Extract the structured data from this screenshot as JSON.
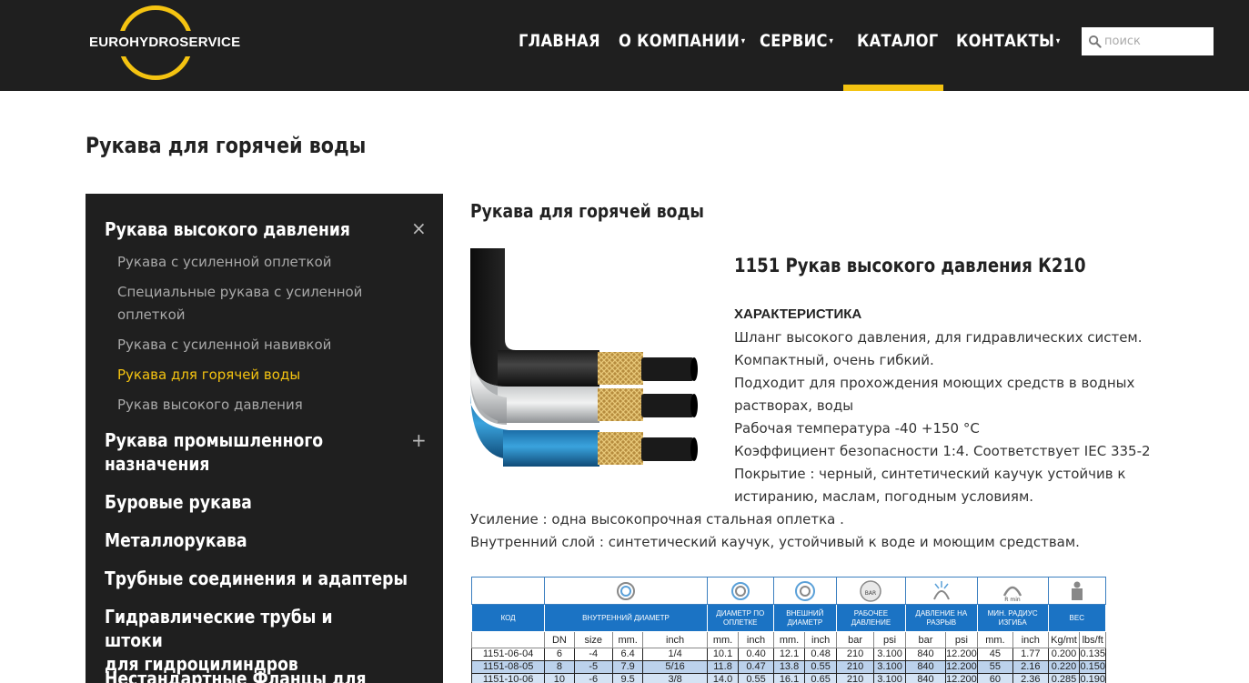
{
  "header": {
    "logo_text": "EUROHYDROSERVICE",
    "nav": [
      {
        "label": "ГЛАВНАЯ",
        "has_dropdown": false
      },
      {
        "label": "О КОМПАНИИ",
        "has_dropdown": true
      },
      {
        "label": "СЕРВИС",
        "has_dropdown": true
      },
      {
        "label": "КАТАЛОГ",
        "has_dropdown": false,
        "active": true
      },
      {
        "label": "КОНТАКТЫ",
        "has_dropdown": true
      }
    ],
    "dropdown_caret": "▾",
    "search_placeholder": "поиск"
  },
  "page_title": "Рукава для горячей воды",
  "sidebar": {
    "categories": [
      {
        "label": "Рукава высокого давления",
        "toggle": "×"
      },
      {
        "label": "Рукава промышленного\nназначения",
        "toggle": "+"
      },
      {
        "label": "Буровые рукава"
      },
      {
        "label": "Металлорукава"
      },
      {
        "label": "Трубные соединения и адаптеры"
      },
      {
        "label": "Гидравлические трубы и штоки\nдля гидроцилиндров"
      },
      {
        "label": "Нестандартные Фланцы для"
      }
    ],
    "subitems": [
      {
        "label": "Рукава с усиленной оплеткой"
      },
      {
        "label": "Специальные рукава с усиленной оплеткой"
      },
      {
        "label": "Рукава с усиленной навивкой"
      },
      {
        "label": "Рукава для горячей воды",
        "active": true
      },
      {
        "label": "Рукав высокого давления"
      }
    ]
  },
  "content": {
    "section_title": "Рукава для горячей воды",
    "product_title": "1151 Рукав высокого давления К210",
    "spec_heading": "ХАРАКТЕРИСТИКА",
    "spec_lines": [
      "Шланг высокого давления, для гидравлических систем.",
      "Компактный, очень гибкий.",
      "Подходит для прохождения моющих средств в водных",
      "растворах, воды",
      "Рабочая температура -40  +150 °С",
      "Коэффициент безопасности 1:4. Соответствует IEC 335-2",
      "Покрытие : черный, синтетический каучук устойчив к",
      "истиранию, маслам, погодным условиям.",
      "Усиление : одна высокопрочная стальная оплетка .",
      "Внутренний слой : синтетический каучук, устойчивый к воде и моющим средствам."
    ],
    "colors": {
      "accent": "#f4c311",
      "header_bg": "#1f1f1f",
      "table_header": "#1b73c4"
    }
  },
  "table": {
    "icon_badges": {
      "pressure": "BAR",
      "bend": "R min"
    },
    "headers": {
      "code": "КОД",
      "inner": "ВНУТРЕННИЙ ДИАМЕТР",
      "braid": "ДИАМЕТР ПО ОПЛЕТКЕ",
      "outer": "ВНЕШНИЙ ДИАМЕТР",
      "work": "РАБОЧЕЕ ДАВЛЕНИЕ",
      "burst": "ДАВЛЕНИЕ НА РАЗРЫВ",
      "bend": "МИН. РАДИУС ИЗГИБА",
      "weight": "ВЕС"
    },
    "units": [
      "DN",
      "size",
      "mm.",
      "inch",
      "mm.",
      "inch",
      "mm.",
      "inch",
      "bar",
      "psi",
      "bar",
      "psi",
      "mm.",
      "inch",
      "Kg/mt",
      "lbs/ft"
    ],
    "rows": [
      [
        "1151-06-04",
        "6",
        "-4",
        "6.4",
        "1/4",
        "10.1",
        "0.40",
        "12.1",
        "0.48",
        "210",
        "3.100",
        "840",
        "12.200",
        "45",
        "1.77",
        "0.200",
        "0.135"
      ],
      [
        "1151-08-05",
        "8",
        "-5",
        "7.9",
        "5/16",
        "11.8",
        "0.47",
        "13.8",
        "0.55",
        "210",
        "3.100",
        "840",
        "12.200",
        "55",
        "2.16",
        "0.220",
        "0.150"
      ],
      [
        "1151-10-06",
        "10",
        "-6",
        "9.5",
        "3/8",
        "14.0",
        "0.55",
        "16.1",
        "0.65",
        "210",
        "3.100",
        "840",
        "12.200",
        "60",
        "2.36",
        "0.285",
        "0.190"
      ]
    ]
  }
}
